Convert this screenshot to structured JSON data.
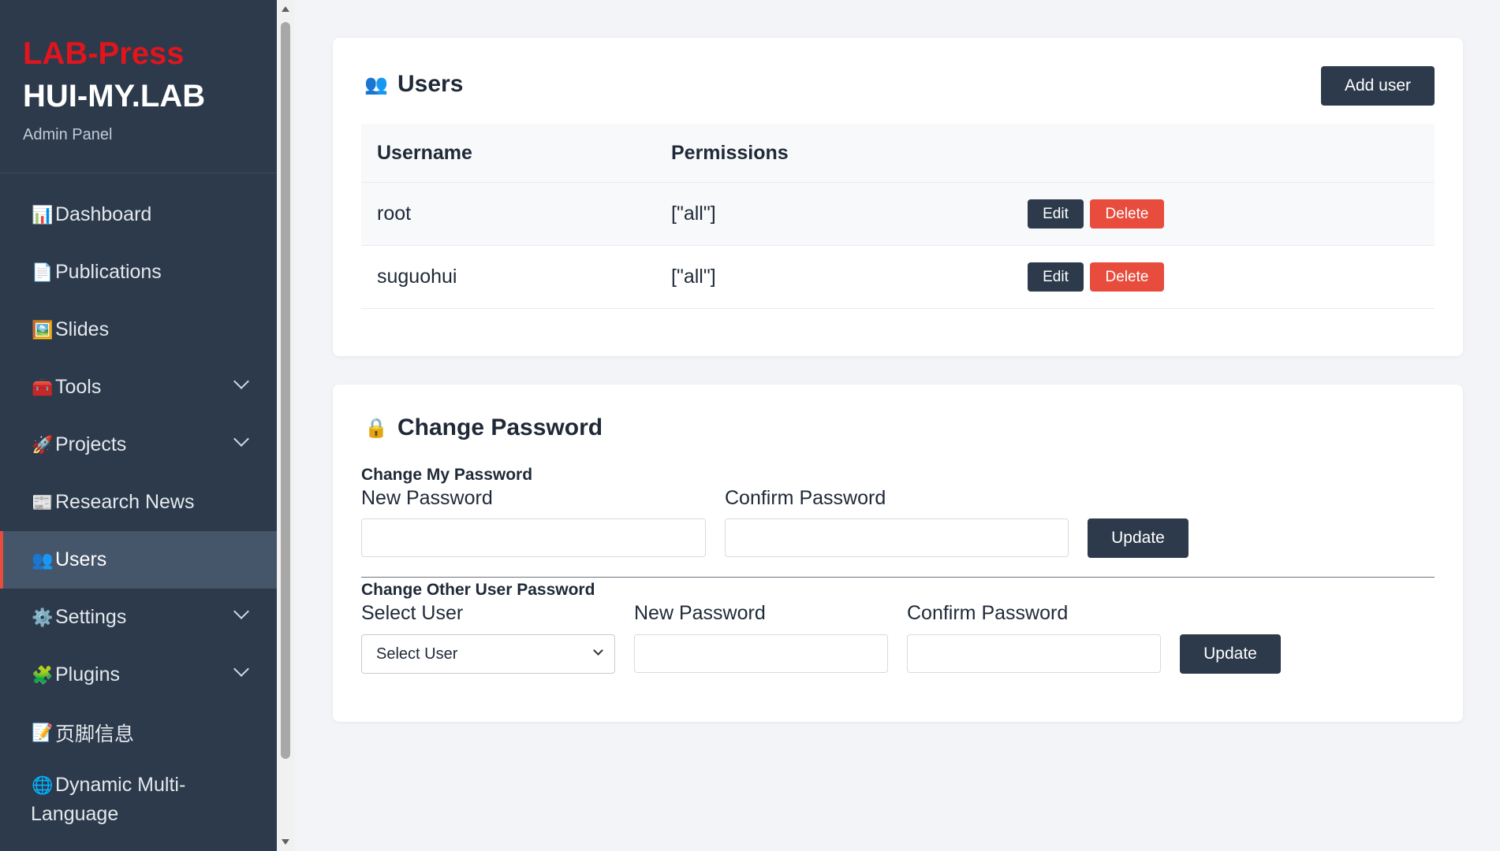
{
  "sidebar": {
    "brand_top": "LAB-Press",
    "brand_name": "HUI-MY.LAB",
    "brand_sub": "Admin Panel",
    "items": [
      {
        "icon": "📊",
        "label": "Dashboard"
      },
      {
        "icon": "📄",
        "label": "Publications"
      },
      {
        "icon": "🖼️",
        "label": "Slides"
      },
      {
        "icon": "🧰",
        "label": "Tools"
      },
      {
        "icon": "🚀",
        "label": "Projects"
      },
      {
        "icon": "📰",
        "label": "Research News"
      },
      {
        "icon": "👥",
        "label": "Users"
      },
      {
        "icon": "⚙️",
        "label": "Settings"
      },
      {
        "icon": "🧩",
        "label": "Plugins"
      },
      {
        "icon": "📝",
        "label": "页脚信息"
      },
      {
        "icon": "🌐",
        "label_line1": "Dynamic Multi-",
        "label_line2": "Language"
      }
    ]
  },
  "users_card": {
    "icon": "👥",
    "title": "Users",
    "add_button": "Add user",
    "columns": [
      "Username",
      "Permissions"
    ],
    "rows": [
      {
        "username": "root",
        "permissions": "[\"all\"]",
        "edit": "Edit",
        "delete": "Delete"
      },
      {
        "username": "suguohui",
        "permissions": "[\"all\"]",
        "edit": "Edit",
        "delete": "Delete"
      }
    ]
  },
  "password_card": {
    "icon": "🔒",
    "title": "Change Password",
    "my_section": {
      "heading": "Change My Password",
      "new_label": "New Password",
      "confirm_label": "Confirm Password",
      "new_value": "",
      "confirm_value": "",
      "update_label": "Update"
    },
    "other_section": {
      "heading": "Change Other User Password",
      "select_label": "Select User",
      "select_value": "Select User",
      "new_label": "New Password",
      "confirm_label": "Confirm Password",
      "new_value": "",
      "confirm_value": "",
      "update_label": "Update"
    }
  },
  "colors": {
    "sidebar_bg": "#2c3a4b",
    "brand_accent": "#e0151d",
    "active_marker": "#e74c3c",
    "button_dark": "#2c3a4b",
    "button_danger": "#e74c3c"
  }
}
